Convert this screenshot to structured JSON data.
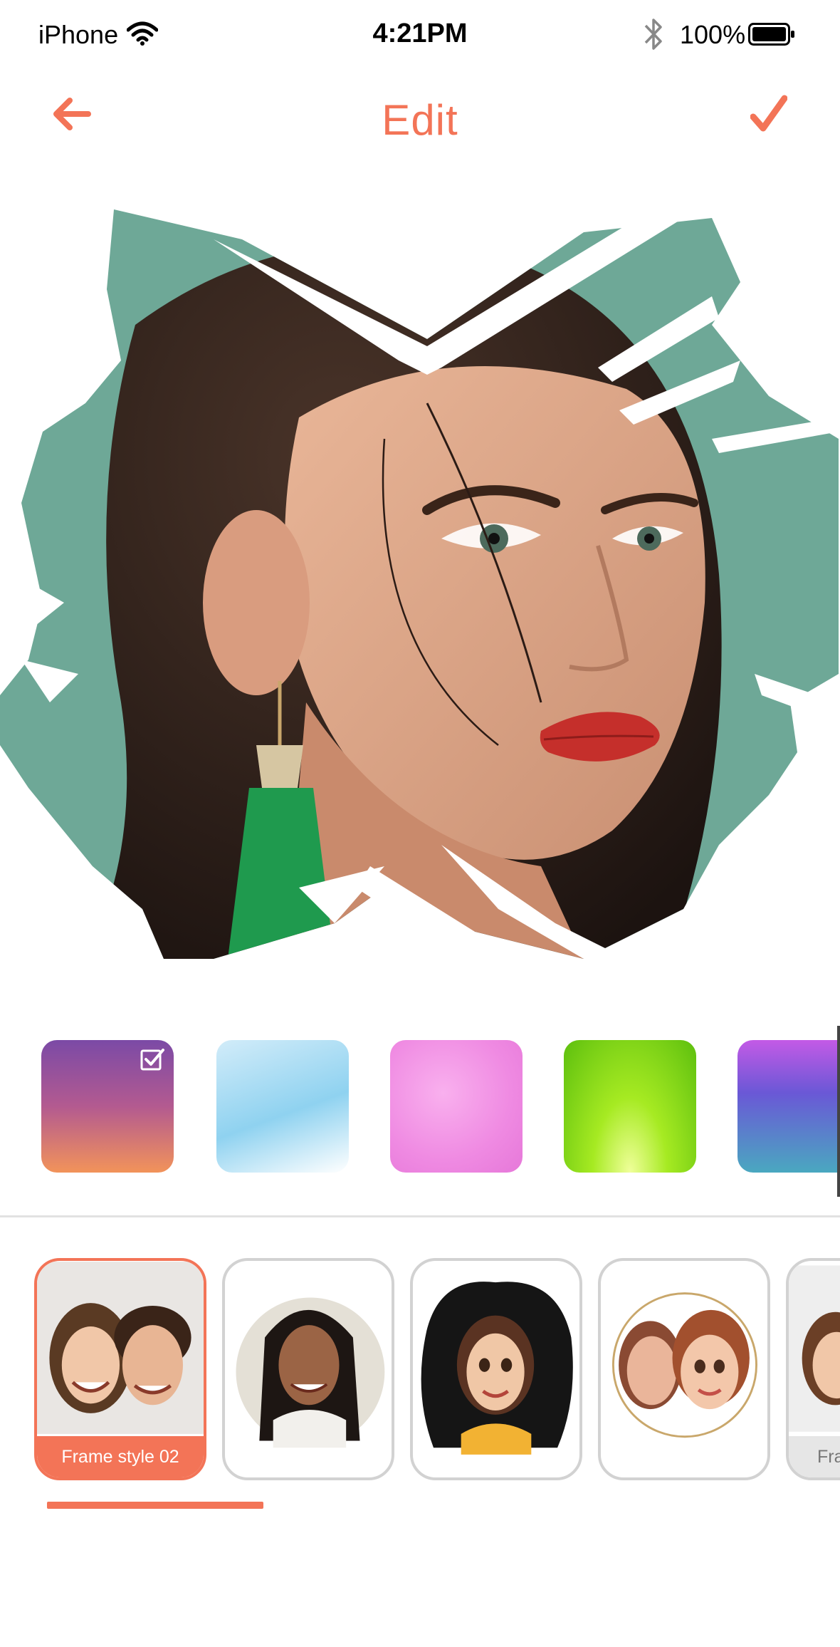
{
  "status_bar": {
    "carrier": "iPhone",
    "time": "4:21PM",
    "battery_percent": "100%",
    "icons": [
      "wifi-icon",
      "bluetooth-icon",
      "battery-icon"
    ]
  },
  "header": {
    "title": "Edit",
    "back_icon": "arrow-left-icon",
    "confirm_icon": "checkmark-icon"
  },
  "colors": {
    "accent": "#f37457",
    "divider": "#e2e2e2",
    "card_border": "#d2d2d2"
  },
  "backgrounds": {
    "items": [
      {
        "name": "purple-orange-sparkle",
        "selected": true
      },
      {
        "name": "light-blue-sparkle",
        "selected": false
      },
      {
        "name": "pink-bokeh",
        "selected": false
      },
      {
        "name": "lime-green-rays",
        "selected": false
      },
      {
        "name": "purple-teal-sparkle",
        "selected": false
      }
    ]
  },
  "frames": {
    "items": [
      {
        "label": "Frame style 02",
        "selected": true
      },
      {
        "label": "",
        "selected": false
      },
      {
        "label": "",
        "selected": false
      },
      {
        "label": "",
        "selected": false
      },
      {
        "label": "Fra",
        "selected": false
      }
    ]
  }
}
